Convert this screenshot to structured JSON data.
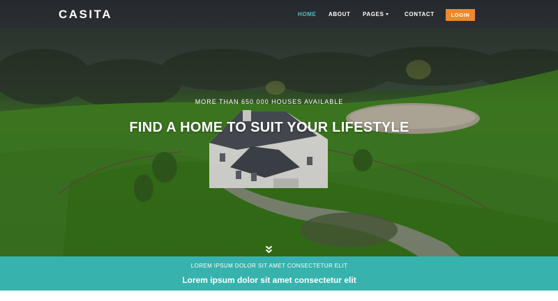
{
  "brand": "CASITA",
  "nav": {
    "home": "HOME",
    "about": "ABOUT",
    "pages": "PAGES",
    "contact": "CONTACT",
    "login": "LOGIN"
  },
  "hero": {
    "subheading": "MORE THAN 650 000 HOUSES AVAILABLE",
    "headline": "FIND A HOME TO SUIT YOUR LIFESTYLE",
    "scroll_icon": "double-chevron-down-icon"
  },
  "banner": {
    "small": "LOREM IPSUM DOLOR SIT AMET CONSECTETUR ELIT",
    "large": "Lorem ipsum dolor sit amet consectetur elit"
  },
  "colors": {
    "accent": "#4fc0c4",
    "login": "#f0892a",
    "banner": "#38b2ad"
  }
}
